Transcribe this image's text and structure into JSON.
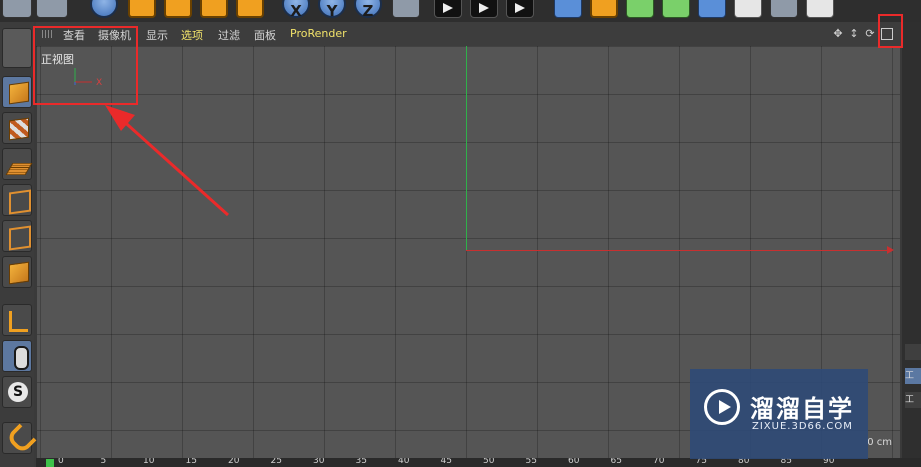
{
  "toolbar": {
    "buttons": [
      {
        "name": "live-selection-icon"
      },
      {
        "name": "move-tool-icon"
      },
      {
        "name": "scale-tool-icon"
      },
      {
        "name": "rotate-tool-icon"
      },
      {
        "name": "last-tool-icon"
      },
      {
        "name": "x-axis-lock",
        "label": "X"
      },
      {
        "name": "y-axis-lock",
        "label": "Y"
      },
      {
        "name": "z-axis-lock",
        "label": "Z"
      },
      {
        "name": "coordinate-system-icon"
      },
      {
        "name": "render-view-icon"
      },
      {
        "name": "render-to-picture-viewer-icon"
      },
      {
        "name": "render-settings-icon"
      },
      {
        "name": "cube-object-icon"
      },
      {
        "name": "spline-pen-icon"
      },
      {
        "name": "subdivision-surface-icon"
      },
      {
        "name": "cloner-icon"
      },
      {
        "name": "deformer-icon"
      },
      {
        "name": "floor-object-icon"
      },
      {
        "name": "camera-icon"
      },
      {
        "name": "light-icon"
      }
    ]
  },
  "viewport_menu": {
    "items": [
      "查看",
      "摄像机",
      "显示",
      "选项",
      "过滤",
      "面板",
      "ProRender"
    ]
  },
  "viewport": {
    "view_name": "正视图",
    "mini_axis_x": "X",
    "unit_text": "0 cm"
  },
  "right_panel": {
    "tab1": "工",
    "tab2": "工"
  },
  "watermark": {
    "title": "溜溜自学",
    "url": "ZIXUE.3D66.COM"
  },
  "timeline": {
    "ticks": [
      "0",
      "5",
      "10",
      "15",
      "20",
      "25",
      "30",
      "35",
      "40",
      "45",
      "50",
      "55",
      "60",
      "65",
      "70",
      "75",
      "80",
      "85",
      "90"
    ]
  },
  "colors": {
    "annotation": "#ea2a2a",
    "y_axis": "#2fb04a",
    "x_axis": "#c83030",
    "menu_highlight": "#f2e36a"
  }
}
